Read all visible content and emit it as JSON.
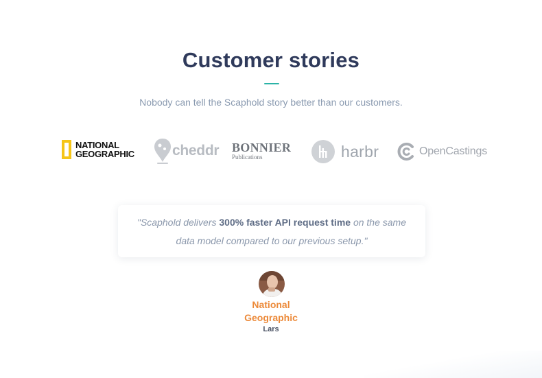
{
  "section": {
    "title": "Customer stories",
    "subtitle": "Nobody can tell the Scaphold story better than our customers."
  },
  "logos": [
    {
      "name": "national-geographic",
      "line1": "NATIONAL",
      "line2": "GEOGRAPHIC"
    },
    {
      "name": "cheddr",
      "text": "cheddr"
    },
    {
      "name": "bonnier",
      "main": "BONNIER",
      "sub": "Publications"
    },
    {
      "name": "harbr",
      "text": "harbr"
    },
    {
      "name": "opencastings",
      "text": "OpenCastings"
    }
  ],
  "testimonial": {
    "quote_before": "\"Scaphold delivers ",
    "quote_bold": "300% faster API request time",
    "quote_after": " on the same data model compared to our previous setup.\"",
    "company_line1": "National",
    "company_line2": "Geographic",
    "person": "Lars"
  },
  "colors": {
    "title": "#2f3a5b",
    "accent_divider": "#2bb3a7",
    "company": "#ec8a3a",
    "ng_yellow": "#f5c518"
  },
  "icons": [
    "ng-yellow-frame-icon",
    "cheddr-pin-icon",
    "harbr-circle-icon",
    "opencastings-c-icon",
    "avatar"
  ]
}
